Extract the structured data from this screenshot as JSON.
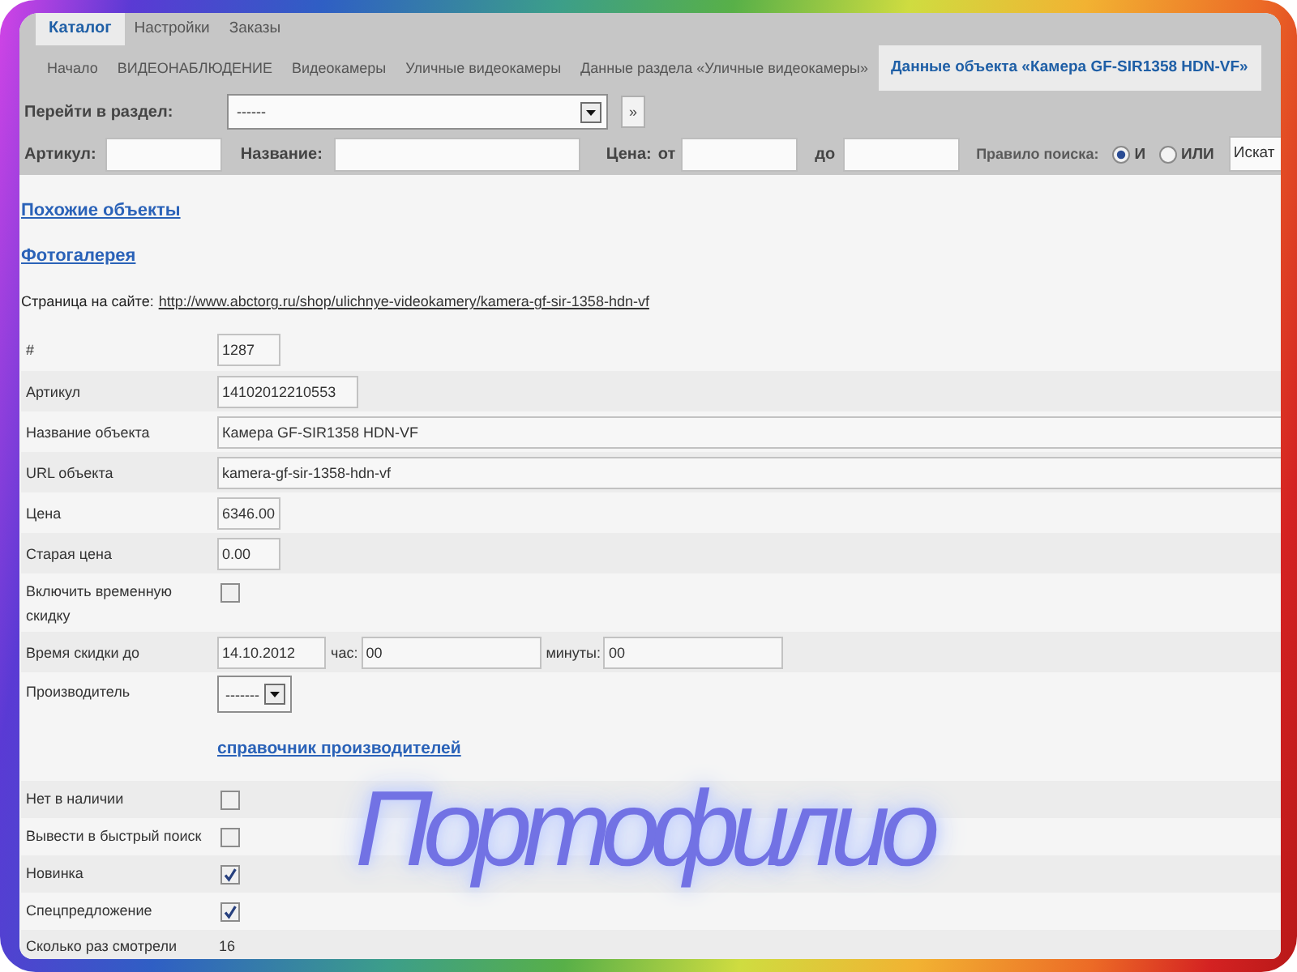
{
  "tabs": [
    {
      "label": "Каталог",
      "selected": true
    },
    {
      "label": "Настройки",
      "selected": false
    },
    {
      "label": "Заказы",
      "selected": false
    }
  ],
  "breadcrumbs": [
    {
      "label": "Начало",
      "selected": false
    },
    {
      "label": "ВИДЕОНАБЛЮДЕНИЕ",
      "selected": false
    },
    {
      "label": "Видеокамеры",
      "selected": false
    },
    {
      "label": "Уличные видеокамеры",
      "selected": false
    },
    {
      "label": "Данные раздела «Уличные видеокамеры»",
      "selected": false
    },
    {
      "label": "Данные объекта «Камера GF-SIR1358 HDN-VF»",
      "selected": true
    }
  ],
  "section_jump": {
    "label": "Перейти в раздел:",
    "value": "------",
    "button": "»"
  },
  "search": {
    "article_label": "Артикул:",
    "name_label": "Название:",
    "price_label": "Цена:",
    "from_label": "от",
    "to_label": "до",
    "rule_label": "Правило поиска:",
    "rule_options": [
      {
        "label": "И",
        "selected": true
      },
      {
        "label": "ИЛИ",
        "selected": false
      }
    ],
    "button": "Искат"
  },
  "links": [
    "Похожие объекты",
    "Фотогалерея"
  ],
  "site_page": {
    "label": "Страница на сайте:",
    "url": "http://www.abctorg.ru/shop/ulichnye-videokamery/kamera-gf-sir-1358-hdn-vf"
  },
  "form_rows": [
    {
      "kind": "short",
      "label": "#",
      "value": "1287"
    },
    {
      "kind": "medium",
      "label": "Артикул",
      "value": "14102012210553"
    },
    {
      "kind": "wide",
      "label": "Название объекта",
      "value": "Камера GF-SIR1358 HDN-VF"
    },
    {
      "kind": "wide",
      "label": "URL объекта",
      "value": "kamera-gf-sir-1358-hdn-vf"
    },
    {
      "kind": "short",
      "label": "Цена",
      "value": "6346.00"
    },
    {
      "kind": "short",
      "label": "Старая цена",
      "value": "0.00"
    },
    {
      "kind": "checkbox",
      "label": "Включить временную скидку",
      "checked": false
    },
    {
      "kind": "datetime",
      "label": "Время скидки до",
      "date": "14.10.2012",
      "hour_label": "час:",
      "hour": "00",
      "minute_label": "минуты:",
      "minute": "00"
    },
    {
      "kind": "select",
      "label": "Производитель",
      "value": "-------",
      "link": "справочник производителей"
    },
    {
      "kind": "checkbox",
      "label": "Нет в наличии",
      "checked": false
    },
    {
      "kind": "checkbox",
      "label": "Вывести в быстрый поиск",
      "checked": false
    },
    {
      "kind": "checkbox",
      "label": "Новинка",
      "checked": true
    },
    {
      "kind": "checkbox",
      "label": "Спецпредложение",
      "checked": true
    },
    {
      "kind": "text",
      "label": "Сколько раз смотрели",
      "value": "16"
    }
  ],
  "overlay_title": "Портофилио"
}
